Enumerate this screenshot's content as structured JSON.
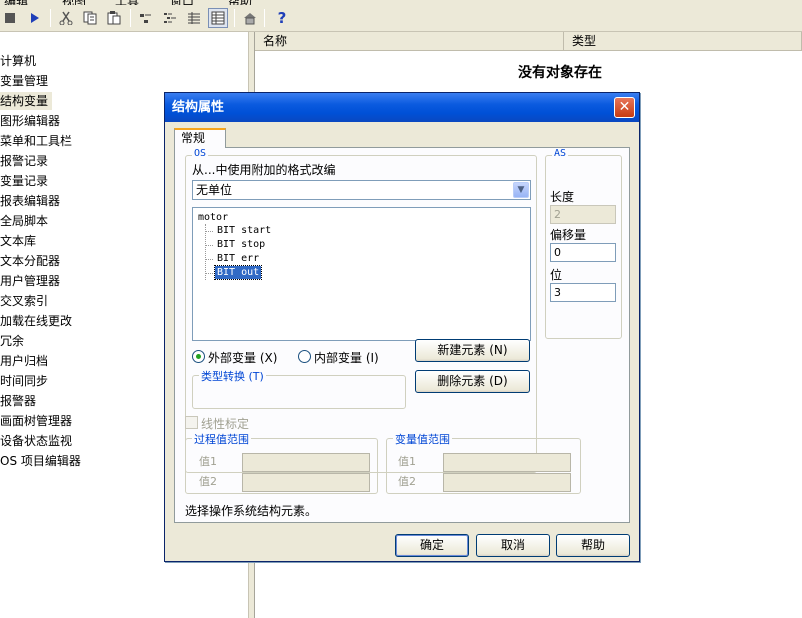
{
  "menubar": {
    "items": [
      "编辑",
      "视图",
      "工具",
      "窗口",
      "帮助"
    ]
  },
  "toolbar": {
    "buttons": [
      "stop-icon",
      "run-icon",
      "cut-icon",
      "copy-icon",
      "paste-icon",
      "small-icons-icon",
      "list-icon",
      "details-icon",
      "table-icon",
      "properties-icon",
      "help-icon"
    ]
  },
  "tree": {
    "items": [
      "计算机",
      "变量管理",
      "结构变量",
      "图形编辑器",
      "菜单和工具栏",
      "报警记录",
      "变量记录",
      "报表编辑器",
      "全局脚本",
      "文本库",
      "文本分配器",
      "用户管理器",
      "交叉索引",
      "加载在线更改",
      "冗余",
      "用户归档",
      "时间同步",
      "报警器",
      "画面树管理器",
      "设备状态监视",
      "OS 项目编辑器"
    ],
    "selected_index": 2
  },
  "list": {
    "col_name": "名称",
    "col_type": "类型",
    "empty": "没有对象存在"
  },
  "dialog": {
    "title": "结构属性",
    "close": "✕",
    "tab": "常规",
    "os_group": "OS",
    "format_label": "从...中使用附加的格式改编",
    "unit_value": "无单位",
    "tree_root": "motor",
    "elements": [
      "BIT start",
      "BIT stop",
      "BIT err",
      "BIT out"
    ],
    "selected_element": 3,
    "radio_external": "外部变量 (X)",
    "radio_internal": "内部变量 (I)",
    "type_conv_group": "类型转换 (T)",
    "new_element": "新建元素 (N)",
    "delete_element": "删除元素 (D)",
    "as_group": "AS",
    "length_label": "长度",
    "length_value": "2",
    "offset_label": "偏移量",
    "offset_value": "0",
    "bit_label": "位",
    "bit_value": "3",
    "linear_label": "线性标定",
    "process_group": "过程值范围",
    "variable_group": "变量值范围",
    "value1": "值1",
    "value2": "值2",
    "status": "选择操作系统结构元素。",
    "ok": "确定",
    "cancel": "取消",
    "help": "帮助"
  }
}
